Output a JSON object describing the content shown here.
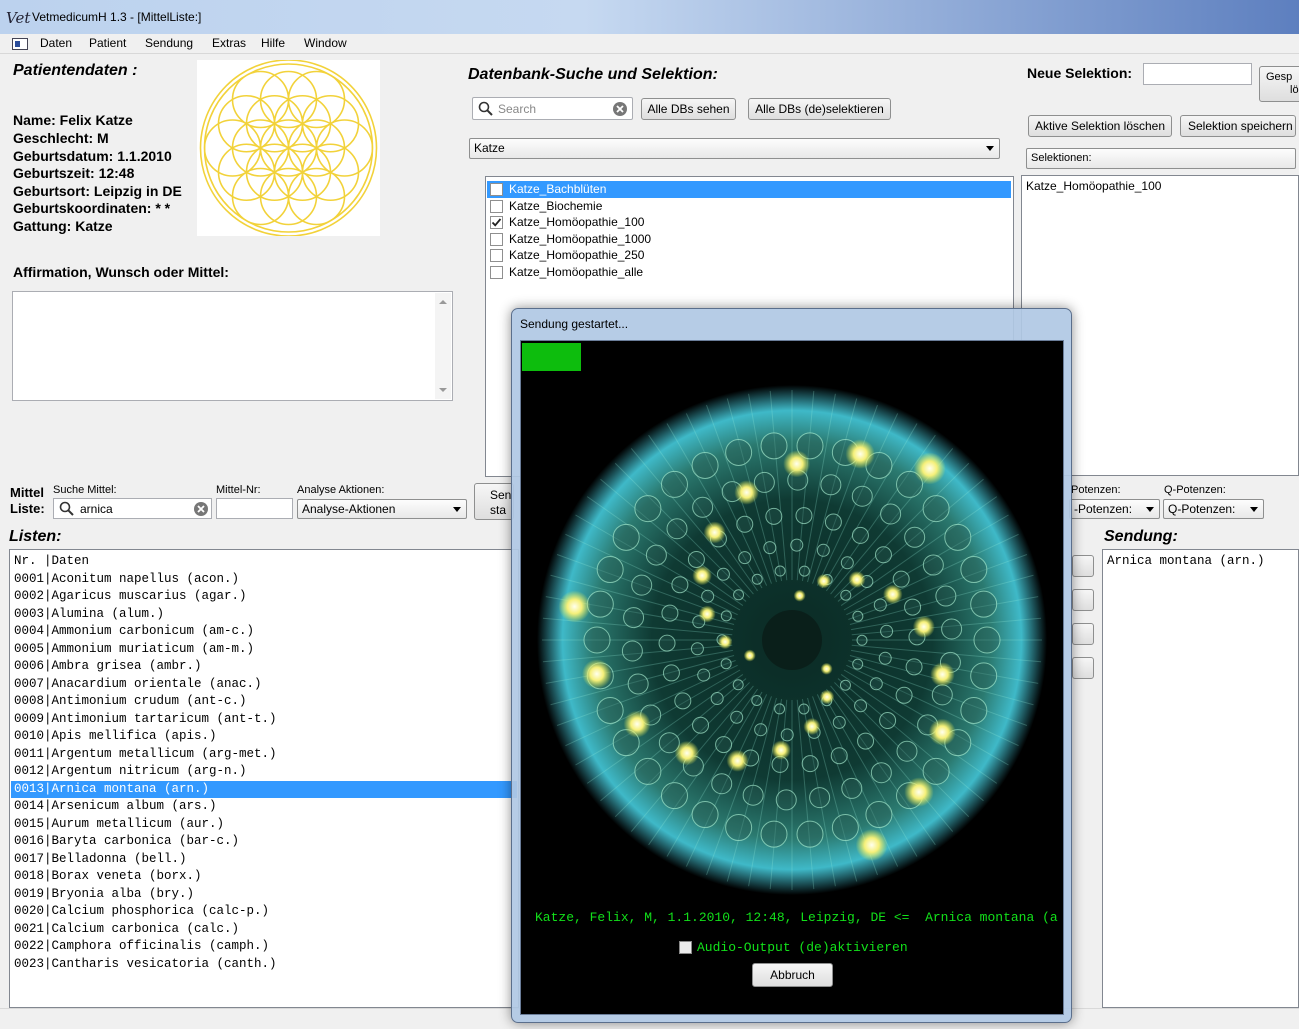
{
  "window": {
    "logo": "Vet",
    "title": "VetmedicumH 1.3 - [MittelListe:]"
  },
  "menu": [
    "Daten",
    "Patient",
    "Sendung",
    "Extras",
    "Hilfe",
    "Window"
  ],
  "patient": {
    "heading": "Patientendaten :",
    "name": "Name: Felix Katze",
    "sex": "Geschlecht: M",
    "birthdate": "Geburtsdatum: 1.1.2010",
    "birthtime": "Geburtszeit: 12:48",
    "birthplace": "Geburtsort: Leipzig in DE",
    "coords": "Geburtskoordinaten: * *",
    "species": "Gattung: Katze",
    "affirmation_label": "Affirmation, Wunsch oder Mittel:",
    "affirmation_value": ""
  },
  "db": {
    "heading": "Datenbank-Suche und Selektion:",
    "search_placeholder": "Search",
    "btn_all_dbs": "Alle DBs sehen",
    "btn_select_all": "Alle DBs (de)selektieren",
    "combo_value": "Katze",
    "items": [
      {
        "label": "Katze_Bachblüten",
        "checked": false,
        "selected": true
      },
      {
        "label": "Katze_Biochemie",
        "checked": false,
        "selected": false
      },
      {
        "label": "Katze_Homöopathie_100",
        "checked": true,
        "selected": false
      },
      {
        "label": "Katze_Homöopathie_1000",
        "checked": false,
        "selected": false
      },
      {
        "label": "Katze_Homöopathie_250",
        "checked": false,
        "selected": false
      },
      {
        "label": "Katze_Homöopathie_alle",
        "checked": false,
        "selected": false
      }
    ]
  },
  "selection": {
    "label": "Neue Selektion:",
    "input_value": "",
    "btn_saved_line1": "Gesp",
    "btn_saved_line2": "lö",
    "btn_clear": "Aktive Selektion löschen",
    "btn_save": "Selektion speichern",
    "combo_value": "Selektionen:",
    "items": [
      "Katze_Homöopathie_100"
    ]
  },
  "mittel": {
    "label_line1": "Mittel",
    "label_line2": "Liste:",
    "search_label": "Suche Mittel:",
    "search_value": "arnica",
    "nr_label": "Mittel-Nr:",
    "nr_value": "",
    "analyse_label": "Analyse Aktionen:",
    "analyse_value": "Analyse-Aktionen",
    "send_btn_line1": "Sen",
    "send_btn_line2": "sta",
    "c_label": "Potenzen:",
    "c_value": "-Potenzen:",
    "q_label": "Q-Potenzen:",
    "q_value": "Q-Potenzen:"
  },
  "listen": {
    "heading": "Listen:",
    "rows": [
      "Nr. |Daten",
      "0001|Aconitum napellus (acon.)",
      "0002|Agaricus muscarius (agar.)",
      "0003|Alumina (alum.)",
      "0004|Ammonium carbonicum (am-c.)",
      "0005|Ammonium muriaticum (am-m.)",
      "0006|Ambra grisea (ambr.)",
      "0007|Anacardium orientale (anac.)",
      "0008|Antimonium crudum (ant-c.)",
      "0009|Antimonium tartaricum (ant-t.)",
      "0010|Apis mellifica (apis.)",
      "0011|Argentum metallicum (arg-met.)",
      "0012|Argentum nitricum (arg-n.)",
      "0013|Arnica montana (arn.)",
      "0014|Arsenicum album (ars.)",
      "0015|Aurum metallicum (aur.)",
      "0016|Baryta carbonica (bar-c.)",
      "0017|Belladonna (bell.)",
      "0018|Borax veneta (borx.)",
      "0019|Bryonia alba (bry.)",
      "0020|Calcium phosphorica (calc-p.)",
      "0021|Calcium carbonica (calc.)",
      "0022|Camphora officinalis (camph.)",
      "0023|Cantharis vesicatoria (canth.)"
    ],
    "selected_index": 13
  },
  "sendung": {
    "heading": "Sendung:",
    "items": [
      "Arnica montana (arn.)"
    ]
  },
  "modal": {
    "title": "Sendung gestartet...",
    "progress": 0.11,
    "info": "Katze, Felix, M, 1.1.2010, 12:48, Leipzig, DE <=  Arnica montana (a",
    "audio_label": "Audio-Output (de)aktivieren",
    "audio_checked": false,
    "cancel": "Abbruch"
  },
  "colors": {
    "selection": "#3399ff",
    "progress": "#0dbd0d",
    "console_text": "#12e01a",
    "flower": "#f2d23a"
  }
}
